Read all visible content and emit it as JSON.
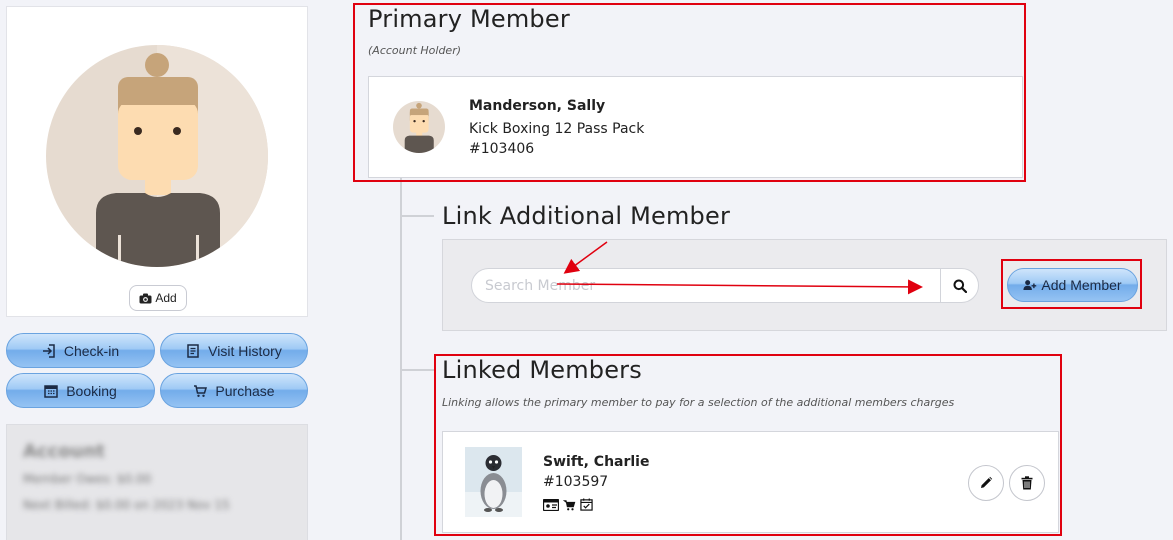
{
  "profile": {
    "add_photo_label": "Add"
  },
  "actions": [
    {
      "label": "Check-in",
      "icon": "sign-in-icon"
    },
    {
      "label": "Visit History",
      "icon": "document-icon"
    },
    {
      "label": "Booking",
      "icon": "calendar-icon"
    },
    {
      "label": "Purchase",
      "icon": "cart-icon"
    }
  ],
  "account": {
    "title": "Account",
    "line1": "Member Owes: $0.00",
    "line2": "Next Billed: $0.00 on 2023 Nov 15"
  },
  "primary": {
    "title": "Primary Member",
    "subtitle": "(Account Holder)",
    "name": "Manderson, Sally",
    "package": "Kick Boxing 12 Pass Pack",
    "number": "#103406"
  },
  "link": {
    "title": "Link Additional Member",
    "search_placeholder": "Search Member",
    "search_value": "",
    "add_member_label": "Add Member"
  },
  "linked": {
    "title": "Linked Members",
    "subtitle": "Linking allows the primary member to pay for a selection of the additional members charges",
    "members": [
      {
        "name": "Swift, Charlie",
        "number": "#103597",
        "icons": [
          "id-card-icon",
          "cart-icon",
          "calendar-check-icon"
        ]
      }
    ]
  },
  "colors": {
    "annotation_red": "#e0000f",
    "button_blue": "#73acea"
  }
}
